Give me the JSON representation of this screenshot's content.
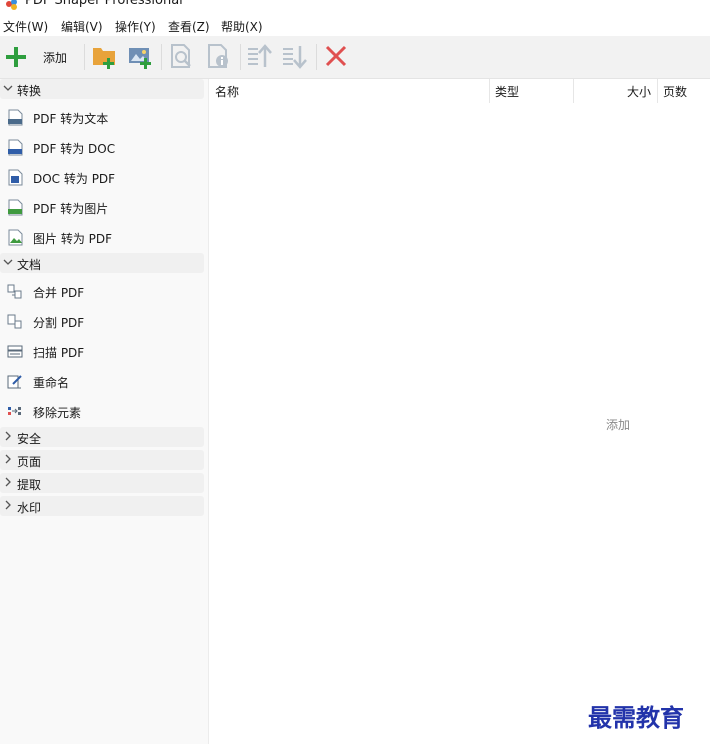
{
  "window": {
    "title": "PDF Shaper Professional"
  },
  "menu": [
    "文件(W)",
    "编辑(V)",
    "操作(Y)",
    "查看(Z)",
    "帮助(X)"
  ],
  "toolbar": {
    "add_label": "添加",
    "icons": [
      "add-icon",
      "add-folder-icon",
      "add-image-icon",
      "preview-icon",
      "properties-icon",
      "move-up-icon",
      "move-down-icon",
      "remove-icon"
    ],
    "colors": {
      "add": "#2e9e3e",
      "folder": "#e8a33b",
      "remove": "#e05050",
      "disabled": "#b8c2cc"
    }
  },
  "sidebar": {
    "sections": [
      {
        "label": "转换",
        "expanded": true,
        "items": [
          {
            "label": "PDF 转为文本",
            "icon": "txt-file-icon"
          },
          {
            "label": "PDF 转为 DOC",
            "icon": "doc-file-icon"
          },
          {
            "label": "DOC 转为 PDF",
            "icon": "word-file-icon"
          },
          {
            "label": "PDF 转为图片",
            "icon": "jpg-file-icon"
          },
          {
            "label": "图片 转为 PDF",
            "icon": "image-file-icon"
          }
        ]
      },
      {
        "label": "文档",
        "expanded": true,
        "items": [
          {
            "label": "合并 PDF",
            "icon": "merge-icon"
          },
          {
            "label": "分割 PDF",
            "icon": "split-icon"
          },
          {
            "label": "扫描 PDF",
            "icon": "scanner-icon"
          },
          {
            "label": "重命名",
            "icon": "rename-icon"
          },
          {
            "label": "移除元素",
            "icon": "remove-elements-icon"
          }
        ]
      },
      {
        "label": "安全",
        "expanded": false,
        "items": []
      },
      {
        "label": "页面",
        "expanded": false,
        "items": []
      },
      {
        "label": "提取",
        "expanded": false,
        "items": []
      },
      {
        "label": "水印",
        "expanded": false,
        "items": []
      }
    ]
  },
  "file_list": {
    "columns": [
      "名称",
      "类型",
      "大小",
      "页数"
    ],
    "empty_text": "添加"
  },
  "watermark": "最需教育"
}
